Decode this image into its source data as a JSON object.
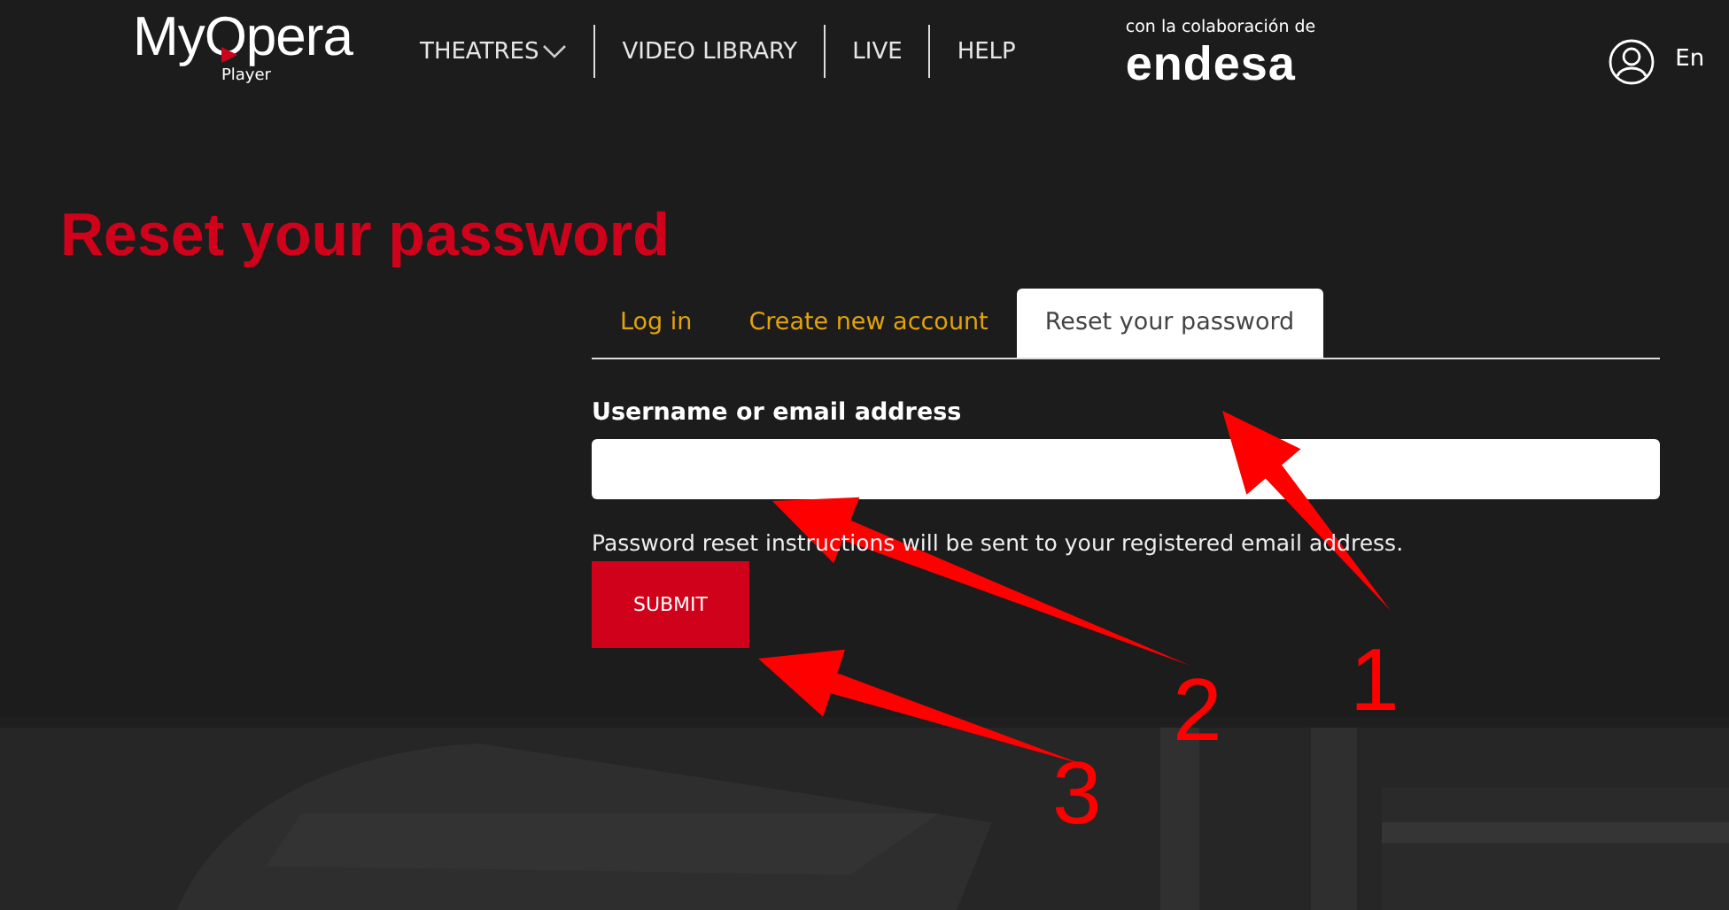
{
  "header": {
    "logo": "MyOpera",
    "logo_sub": "Player",
    "nav": [
      {
        "label": "THEATRES",
        "kind": "dropdown"
      },
      {
        "label": "VIDEO LIBRARY",
        "kind": "link"
      },
      {
        "label": "LIVE",
        "kind": "link"
      },
      {
        "label": "HELP",
        "kind": "link"
      }
    ],
    "sponsor_caption": "con la colaboración de",
    "sponsor": "endesa",
    "language": "En"
  },
  "page_title": "Reset your password",
  "tabs": [
    {
      "label": "Log in",
      "selected": false
    },
    {
      "label": "Create new account",
      "selected": false
    },
    {
      "label": "Reset your password",
      "selected": true
    }
  ],
  "form": {
    "field_label": "Username or email address",
    "help": "Password reset instructions will be sent to your registered email address.",
    "submit": "SUBMIT"
  },
  "annotations": [
    {
      "label": "1"
    },
    {
      "label": "2"
    },
    {
      "label": "3"
    }
  ]
}
